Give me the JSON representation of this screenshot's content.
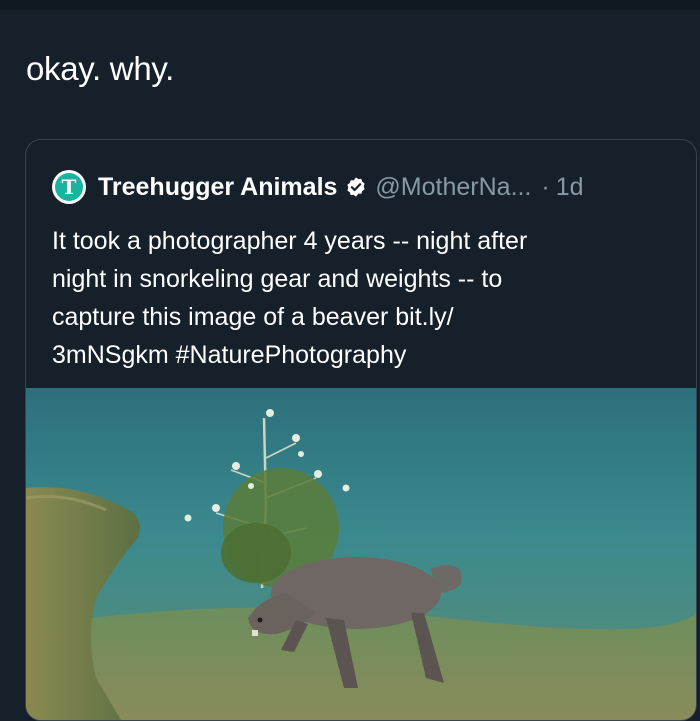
{
  "tweet": {
    "text": "okay. why."
  },
  "quote": {
    "author_name": "Treehugger Animals",
    "handle": "@MotherNa...",
    "separator": "·",
    "time": "1d",
    "avatar_letter": "T",
    "body_line1": "It took a photographer 4 years -- night after",
    "body_line2": "night in snorkeling gear and weights -- to",
    "body_line3": "capture this image of a beaver bit.ly/",
    "body_line4": "3mNSgkm #NaturePhotography"
  },
  "colors": {
    "background": "#15202b",
    "card_border": "#38444d",
    "muted_text": "#8899a6",
    "verified_badge": "#ffffff",
    "avatar_accent": "#19b3a0"
  },
  "icons": {
    "verified": "verified-badge-icon"
  }
}
